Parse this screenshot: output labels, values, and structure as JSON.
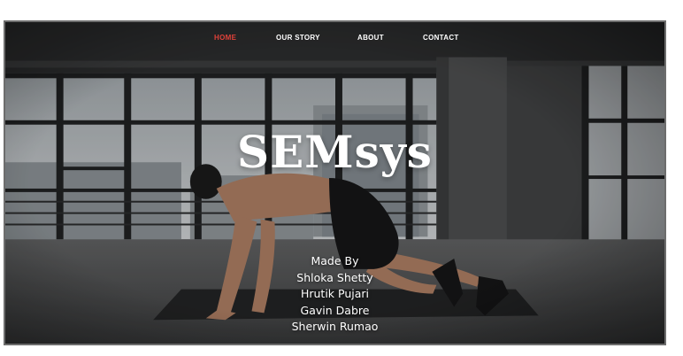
{
  "nav": {
    "items": [
      {
        "label": "HOME",
        "active": true
      },
      {
        "label": "OUR STORY",
        "active": false
      },
      {
        "label": "ABOUT",
        "active": false
      },
      {
        "label": "CONTACT",
        "active": false
      }
    ],
    "active_color": "#e0413a"
  },
  "hero": {
    "title": "SEMsys",
    "credits_heading": "Made By",
    "members": [
      "Shloka Shetty",
      "Hrutik Pujari",
      "Gavin Dabre",
      "Sherwin Rumao"
    ]
  }
}
